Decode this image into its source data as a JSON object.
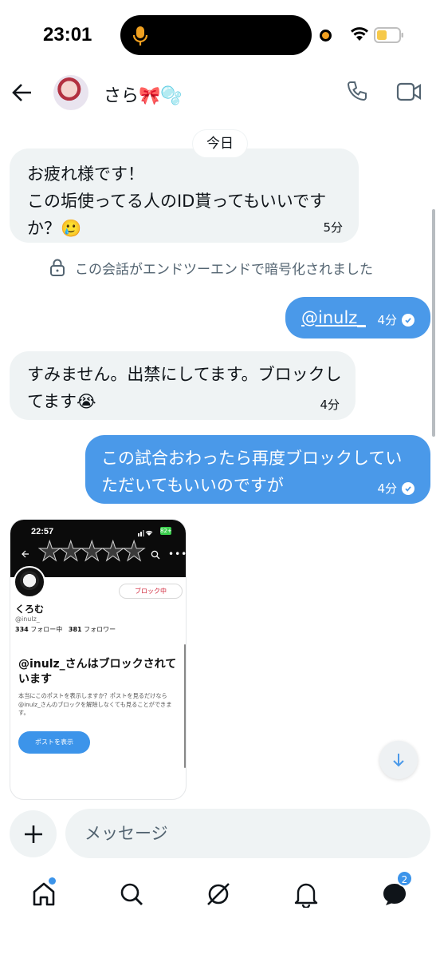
{
  "status_bar": {
    "time": "23:01"
  },
  "header": {
    "contact_name": "さら🎀🫧"
  },
  "chat": {
    "date_label": "今日",
    "messages": [
      {
        "direction": "incoming",
        "text": "お疲れ様です！\nこの垢使ってる人のID貰ってもいいですか？🥲",
        "time": "5分"
      },
      {
        "direction": "outgoing",
        "text": "@inulz_",
        "time": "4分",
        "read": true
      },
      {
        "direction": "incoming",
        "text": "すみません。出禁にしてます。ブロックしてます😭",
        "time": "4分"
      },
      {
        "direction": "outgoing",
        "text": "この試合おわったら再度ブロックしていただいてもいいのですが",
        "time": "4分",
        "read": true
      }
    ],
    "e2e_notice": "この会話がエンドツーエンドで暗号化されました"
  },
  "attachment": {
    "time": "22:57",
    "battery": "82+",
    "stars": "★★★★★",
    "block_button": "ブロック中",
    "name": "くろむ",
    "handle": "@inulz_",
    "following_count": "334",
    "following_label": "フォロー中",
    "followers_count": "381",
    "followers_label": "フォロワー",
    "heading": "@inulz_さんはブロックされています",
    "description": "本当にこのポストを表示しますか？ポストを見るだけなら@inulz_さんのブロックを解除しなくても見ることができます。",
    "show_button": "ポストを表示"
  },
  "composer": {
    "placeholder": "メッセージ"
  },
  "tabbar": {
    "messages_badge": "2"
  },
  "colors": {
    "accent": "#4a99e9",
    "incoming_bg": "#eff3f4",
    "muted": "#536471"
  }
}
